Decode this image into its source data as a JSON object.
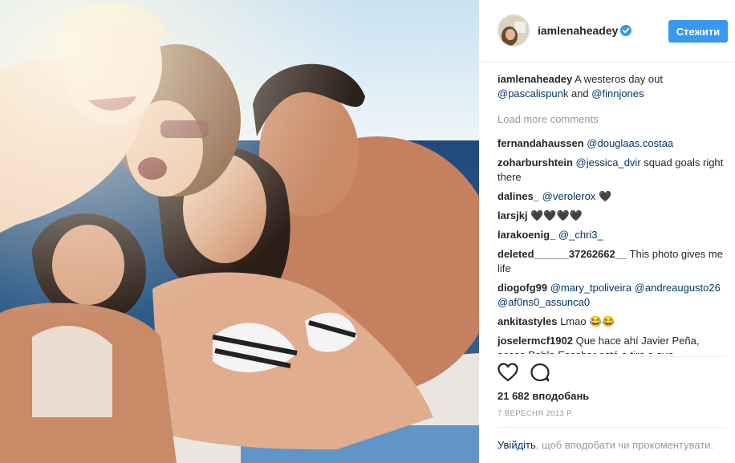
{
  "post": {
    "username": "iamlenaheadey",
    "follow_label": "Стежити",
    "caption": {
      "user": "iamlenaheadey",
      "text_before": " A westeros day out ",
      "mention1": "@pascalispunk",
      "text_middle": " and ",
      "mention2": "@finnjones"
    },
    "load_more": "Load more comments",
    "comments": [
      {
        "user": "fernandahaussen",
        "mention": "@douglaas.costaa",
        "text": ""
      },
      {
        "user": "zoharburshtein",
        "mention": "@jessica_dvir",
        "text": " squad goals right there"
      },
      {
        "user": "dalines_",
        "mention": "@verolerox",
        "text": " 🖤"
      },
      {
        "user": "larsjkj",
        "mention": "",
        "text": "🖤🖤🖤🖤"
      },
      {
        "user": "larakoenig_",
        "mention": "@_chri3_",
        "text": ""
      },
      {
        "user": "deleted______37262662__",
        "mention": "",
        "text": "This photo gives me life"
      },
      {
        "user": "diogofg99",
        "mention": "@mary_tpoliveira @andreaugusto26 @af0ns0_assunca0",
        "text": ""
      },
      {
        "user": "ankitastyles",
        "mention": "",
        "text": "Lmao 😂😂"
      },
      {
        "user": "joselermcf1902",
        "mention": "",
        "text": "Que hace ahí Javier Peña, acaso Pablo Escobar está a tiro o que"
      }
    ],
    "likes": "21 682 вподобань",
    "date": "7 ВЕРЕСНЯ 2013 Р.",
    "login_prompt": {
      "link": "Увійдіть",
      "text": ", щоб вподобати чи прокоментувати."
    },
    "icons": {
      "like": "heart-icon",
      "comment": "comment-bubble-icon",
      "verified": "verified-badge-icon"
    },
    "colors": {
      "accent": "#3897f0",
      "link": "#003569",
      "muted": "#999999",
      "text": "#262626"
    }
  }
}
